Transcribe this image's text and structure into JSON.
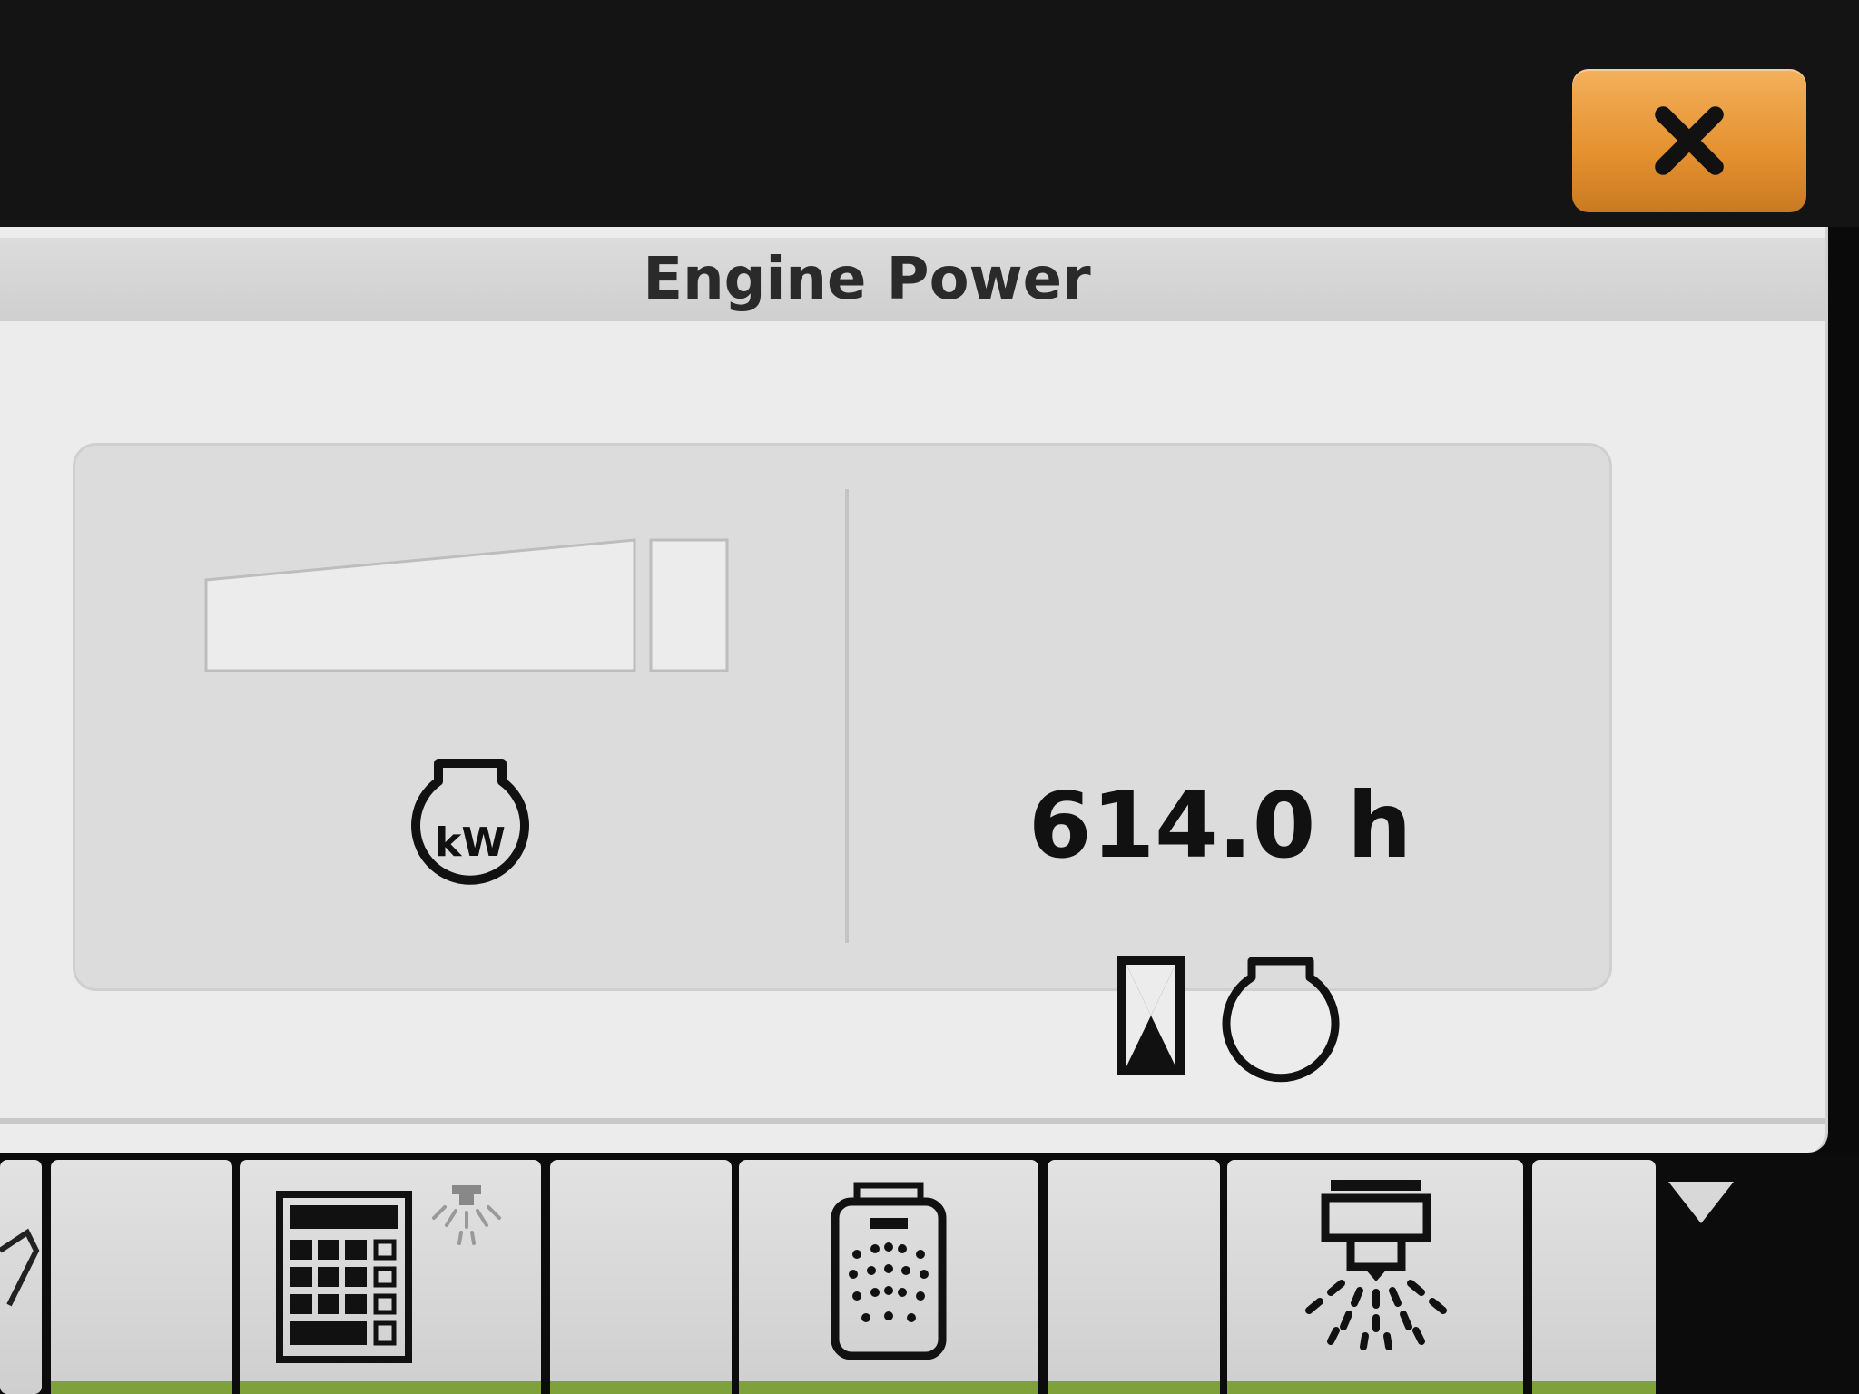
{
  "dialog": {
    "title": "Engine Power"
  },
  "engine_power": {
    "unit_label": "kW",
    "bar_level": 0
  },
  "engine_hours": {
    "value": "614.0 h"
  },
  "icons": {
    "close": "close-icon",
    "power": "engine-power-kw-icon",
    "hourglass": "hourglass-icon",
    "engine": "engine-icon",
    "keypad": "keypad-icon",
    "tank": "tank-spray-icon",
    "nozzle": "spray-nozzle-icon",
    "chevron": "chevron-down-icon"
  },
  "colors": {
    "close_button": "#e4902e",
    "active_strip": "#7fa13a",
    "panel_bg": "#ececec",
    "card_bg": "#dcdcdc"
  }
}
